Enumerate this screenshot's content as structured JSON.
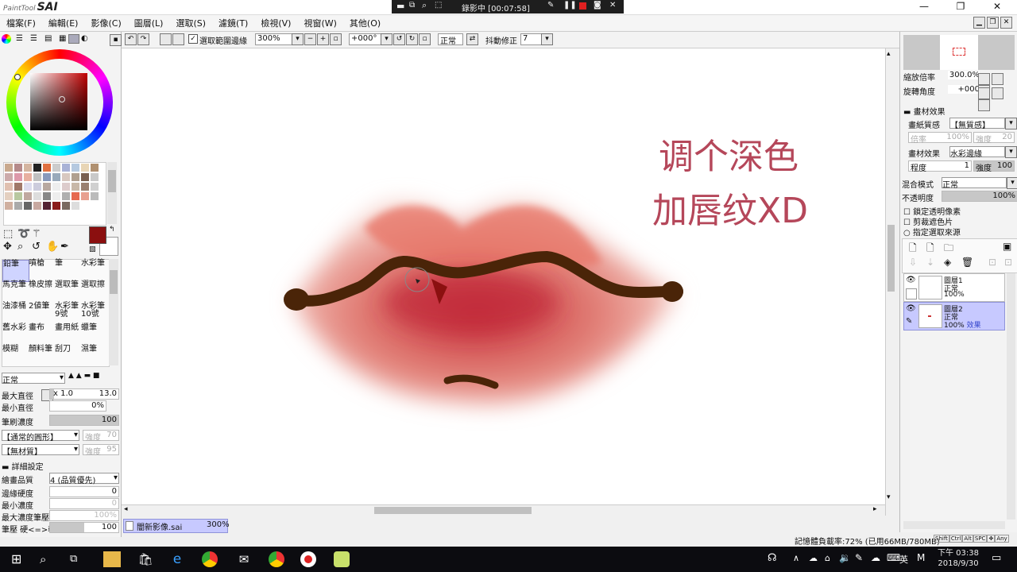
{
  "app": {
    "logo_small": "PaintTool",
    "logo_big": "SAI"
  },
  "recording": {
    "label": "錄影中 [00:07:58]"
  },
  "window_controls": {
    "minimize": "—",
    "restore": "❐",
    "close": "✕"
  },
  "menu": [
    "檔案(F)",
    "編輯(E)",
    "影像(C)",
    "圖層(L)",
    "選取(S)",
    "濾鏡(T)",
    "檢視(V)",
    "視窗(W)",
    "其他(O)"
  ],
  "toolbar": {
    "select_edge_label": "選取範圍邊緣",
    "zoom_value": "300%",
    "rotation_value": "+000°",
    "blend_value": "正常",
    "stabilizer_label": "抖動修正",
    "stabilizer_value": "7"
  },
  "colors": {
    "primary_color": "#8b0f0f",
    "accent_selected": "#c7c9ff",
    "canvas_text": "#b5475a",
    "lip_stroke": "#4a2408"
  },
  "palette_swatches": [
    "#c9a98e",
    "#b58a8a",
    "#d4b5a0",
    "#222222",
    "#e07040",
    "#cccccc",
    "#a9b2d6",
    "#b5c9e0",
    "#e8d5b5",
    "#b09070",
    "#caa",
    "#d9a",
    "#e8b0a0",
    "#c0c0c0",
    "#8899bb",
    "#9ab",
    "#d8c8c0",
    "#b0a090",
    "#7a6050",
    "#c9c9c9",
    "#e0c0b0",
    "#a07868",
    "#dde",
    "#ccd",
    "#b8a8a0",
    "#eee",
    "#dcc",
    "#c8b8a8",
    "#9a8070",
    "#d0d0d0",
    "#e4d0c0",
    "#b8c8a0",
    "#c0a8a0",
    "#ddd",
    "#888888",
    "#eee",
    "#b0b0b0",
    "#e66a50",
    "#e8a090",
    "#bbb",
    "#d0b0a0",
    "#aaa",
    "#666",
    "#c8a8a0",
    "#552233",
    "#8b1c1c",
    "#7a6a60",
    "#ddd"
  ],
  "tools": {
    "selection_tools": [
      "rect-select-icon",
      "lasso-icon",
      "magic-wand-icon",
      "move-icon",
      "zoom-icon",
      "rotate-icon",
      "hand-icon",
      "eyedropper-icon"
    ],
    "brushes": [
      "鉛筆",
      "噴槍",
      "筆",
      "水彩筆",
      "馬克筆",
      "橡皮擦",
      "選取筆",
      "選取擦",
      "油漆桶",
      "2値筆",
      "水彩筆 9號",
      "水彩筆 10號",
      "舊水彩",
      "畫布",
      "畫用紙",
      "蠟筆",
      "模糊",
      "顏料筆",
      "刮刀",
      "濕筆"
    ]
  },
  "brush_settings": {
    "blend_mode": "正常",
    "max_diameter_label": "最大直徑",
    "max_diameter_mult": "x 1.0",
    "max_diameter_value": "13.0",
    "min_diameter_label": "最小直徑",
    "min_diameter_value": "0%",
    "density_label": "筆刷濃度",
    "density_value": "100",
    "shape_label": "【通常的圓形】",
    "shape_strength_label": "強度",
    "shape_strength_value": "70",
    "texture_label": "【無材質】",
    "texture_strength_label": "強度",
    "texture_strength_value": "95",
    "detail_header": "詳細設定",
    "quality_label": "繪畫品質",
    "quality_value": "4 (品質優先)",
    "edge_hardness_label": "邊緣硬度",
    "edge_hardness_value": "0",
    "min_density_label": "最小濃度",
    "min_density_value": "0",
    "max_density_pressure_label": "最大濃度筆壓",
    "max_density_pressure_value": "100%",
    "pressure_label": "筆壓 硬<=>軟",
    "pressure_value": "100"
  },
  "canvas": {
    "annotation_line1": "调个深色",
    "annotation_line2": "加唇纹XD"
  },
  "file_tab": {
    "name": "闇新影像.sai",
    "zoom": "300%"
  },
  "status_bar": {
    "memory": "記憶體負載率:72% (已用66MB/780MB)",
    "keys": [
      "Shift",
      "Ctrl",
      "Alt",
      "SPC",
      "✥",
      "Any"
    ]
  },
  "navigator": {
    "zoom_label": "縮放倍率",
    "zoom_value": "300.0%",
    "rotate_label": "旋轉角度",
    "rotate_value": "+000"
  },
  "layer_props": {
    "effects_header": "畫材效果",
    "paper_label": "畫紙質感",
    "paper_value": "【無質感】",
    "paper_strength_label": "倍率",
    "paper_strength_value": "100%",
    "paper_strength2_label": "強度",
    "paper_strength2_value": "20",
    "material_label": "畫材效果",
    "material_value": "水彩邊緣",
    "degree_label": "程度",
    "degree_value": "1",
    "strength_label": "強度",
    "strength_value": "100",
    "blend_label": "混合模式",
    "blend_value": "正常",
    "opacity_label": "不透明度",
    "opacity_value": "100%",
    "lock_transparency": "鎖定透明像素",
    "clipping": "剪裁遮色片",
    "selection_source": "指定選取來源"
  },
  "layers": [
    {
      "name": "圖層1",
      "mode": "正常",
      "opacity": "100%",
      "effect": ""
    },
    {
      "name": "圖層2",
      "mode": "正常",
      "opacity": "100%",
      "effect": "效果"
    }
  ],
  "taskbar": {
    "time": "下午 03:38",
    "date": "2018/9/30",
    "ime": "英",
    "ime2": "M"
  }
}
